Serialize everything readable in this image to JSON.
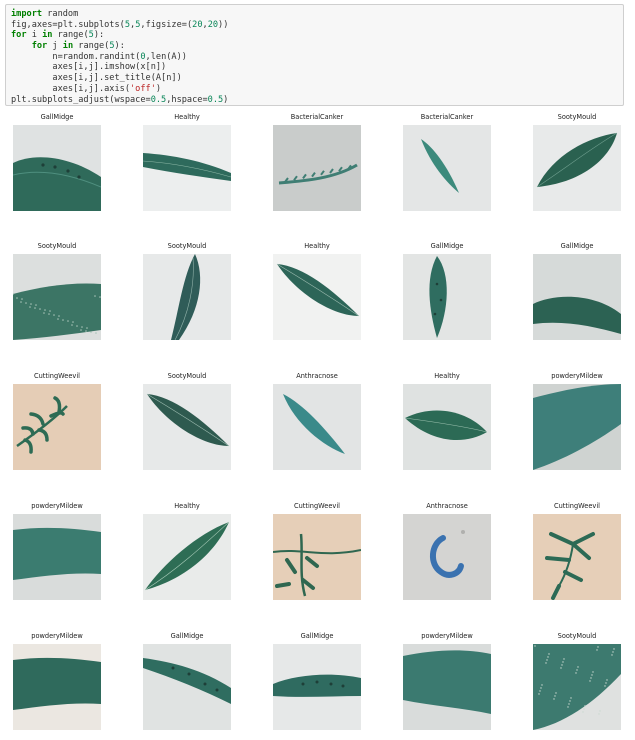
{
  "code": {
    "lines": [
      [
        {
          "t": "import",
          "c": "kw"
        },
        {
          "t": " random",
          "c": ""
        }
      ],
      [
        {
          "t": "fig,axes=plt.subplots(",
          "c": ""
        },
        {
          "t": "5",
          "c": "num"
        },
        {
          "t": ",",
          "c": ""
        },
        {
          "t": "5",
          "c": "num"
        },
        {
          "t": ",figsize=(",
          "c": ""
        },
        {
          "t": "20",
          "c": "num"
        },
        {
          "t": ",",
          "c": ""
        },
        {
          "t": "20",
          "c": "num"
        },
        {
          "t": "))",
          "c": ""
        }
      ],
      [
        {
          "t": "for",
          "c": "kw"
        },
        {
          "t": " i ",
          "c": ""
        },
        {
          "t": "in",
          "c": "kw"
        },
        {
          "t": " range(",
          "c": ""
        },
        {
          "t": "5",
          "c": "num"
        },
        {
          "t": "):",
          "c": ""
        }
      ],
      [
        {
          "t": "    ",
          "c": ""
        },
        {
          "t": "for",
          "c": "kw"
        },
        {
          "t": " j ",
          "c": ""
        },
        {
          "t": "in",
          "c": "kw"
        },
        {
          "t": " range(",
          "c": ""
        },
        {
          "t": "5",
          "c": "num"
        },
        {
          "t": "):",
          "c": ""
        }
      ],
      [
        {
          "t": "        n=random.randint(",
          "c": ""
        },
        {
          "t": "0",
          "c": "num"
        },
        {
          "t": ",len(A))",
          "c": ""
        }
      ],
      [
        {
          "t": "        axes[i,j].imshow(x[n])",
          "c": ""
        }
      ],
      [
        {
          "t": "        axes[i,j].set_title(A[n])",
          "c": ""
        }
      ],
      [
        {
          "t": "        axes[i,j].axis(",
          "c": ""
        },
        {
          "t": "'off'",
          "c": "str"
        },
        {
          "t": ")",
          "c": ""
        }
      ],
      [
        {
          "t": "plt.subplots_adjust(wspace=",
          "c": ""
        },
        {
          "t": "0.5",
          "c": "num"
        },
        {
          "t": ",hspace=",
          "c": ""
        },
        {
          "t": "0.5",
          "c": "num"
        },
        {
          "t": ")",
          "c": ""
        }
      ]
    ]
  },
  "grid": {
    "rows": [
      [
        {
          "title": "GallMidge",
          "bg": "#dfe2e2",
          "leaf": "#2f6a5a",
          "kind": "gall1"
        },
        {
          "title": "Healthy",
          "bg": "#eceeee",
          "leaf": "#2e6a5c",
          "kind": "long_h"
        },
        {
          "title": "BacterialCanker",
          "bg": "#c9cccb",
          "leaf": "#3f7e74",
          "kind": "stem"
        },
        {
          "title": "BacterialCanker",
          "bg": "#e4e6e6",
          "leaf": "#3c8a7c",
          "kind": "diag_small"
        },
        {
          "title": "SootyMould",
          "bg": "#e8eaea",
          "leaf": "#2a6150",
          "kind": "diag_big"
        }
      ],
      [
        {
          "title": "SootyMould",
          "bg": "#dcdfde",
          "leaf": "#3c7565",
          "kind": "sooty_band"
        },
        {
          "title": "SootyMould",
          "bg": "#e7e9e9",
          "leaf": "#2f5c58",
          "kind": "vertical"
        },
        {
          "title": "Healthy",
          "bg": "#f1f2f1",
          "leaf": "#2d6558",
          "kind": "diag_down"
        },
        {
          "title": "GallMidge",
          "bg": "#e3e5e4",
          "leaf": "#2f6d60",
          "kind": "vertical_thin"
        },
        {
          "title": "GallMidge",
          "bg": "#d6dad9",
          "leaf": "#2c6253",
          "kind": "bottom_band"
        }
      ],
      [
        {
          "title": "CuttingWeevil",
          "bg": "#e5cdb6",
          "leaf": "#2d6b54",
          "kind": "weevil"
        },
        {
          "title": "SootyMould",
          "bg": "#e7e9e9",
          "leaf": "#2e5a4f",
          "kind": "diag_down"
        },
        {
          "title": "Anthracnose",
          "bg": "#e2e4e4",
          "leaf": "#3a8a8a",
          "kind": "diag_small_down"
        },
        {
          "title": "Healthy",
          "bg": "#dfe2e1",
          "leaf": "#2c6a55",
          "kind": "center_leaf"
        },
        {
          "title": "powderyMildew",
          "bg": "#cfd3d1",
          "leaf": "#3e7f7a",
          "kind": "fill_tilt"
        }
      ],
      [
        {
          "title": "powderyMildew",
          "bg": "#d9dcdb",
          "leaf": "#3b7c70",
          "kind": "fill_band"
        },
        {
          "title": "Healthy",
          "bg": "#e9ebea",
          "leaf": "#2e6d55",
          "kind": "diag_up"
        },
        {
          "title": "CuttingWeevil",
          "bg": "#e6cfb8",
          "leaf": "#2f6750",
          "kind": "weevil2"
        },
        {
          "title": "Anthracnose",
          "bg": "#d4d4d2",
          "leaf": "#3a72b0",
          "kind": "curl"
        },
        {
          "title": "CuttingWeevil",
          "bg": "#e6cfb8",
          "leaf": "#2c6a55",
          "kind": "weevil3"
        }
      ],
      [
        {
          "title": "powderyMildew",
          "bg": "#ebe7e1",
          "leaf": "#2f6a5c",
          "kind": "fill_band"
        },
        {
          "title": "GallMidge",
          "bg": "#e0e3e2",
          "leaf": "#2f6d60",
          "kind": "gall_top"
        },
        {
          "title": "GallMidge",
          "bg": "#e6e8e8",
          "leaf": "#2f6b60",
          "kind": "gall_mid"
        },
        {
          "title": "powderyMildew",
          "bg": "#d9dcdb",
          "leaf": "#3b7a70",
          "kind": "fill_band2"
        },
        {
          "title": "SootyMould",
          "bg": "#dfe1e0",
          "leaf": "#3d7a6f",
          "kind": "sooty_fill"
        }
      ]
    ]
  }
}
